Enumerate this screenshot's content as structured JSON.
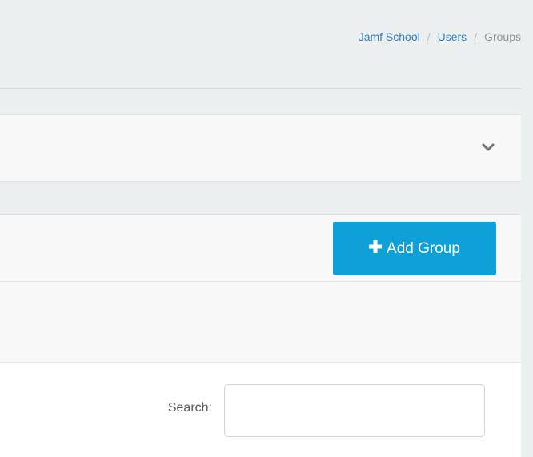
{
  "breadcrumb": {
    "items": [
      "Jamf School",
      "Users"
    ],
    "separator": "/",
    "current": "Groups"
  },
  "filter_panel": {
    "toggle_icon": "chevron-down-icon"
  },
  "toolbar": {
    "add_group_icon": "plus-icon",
    "add_group_label": "Add Group",
    "accent_color": "#0fa0d8"
  },
  "search": {
    "label": "Search:",
    "value": ""
  }
}
